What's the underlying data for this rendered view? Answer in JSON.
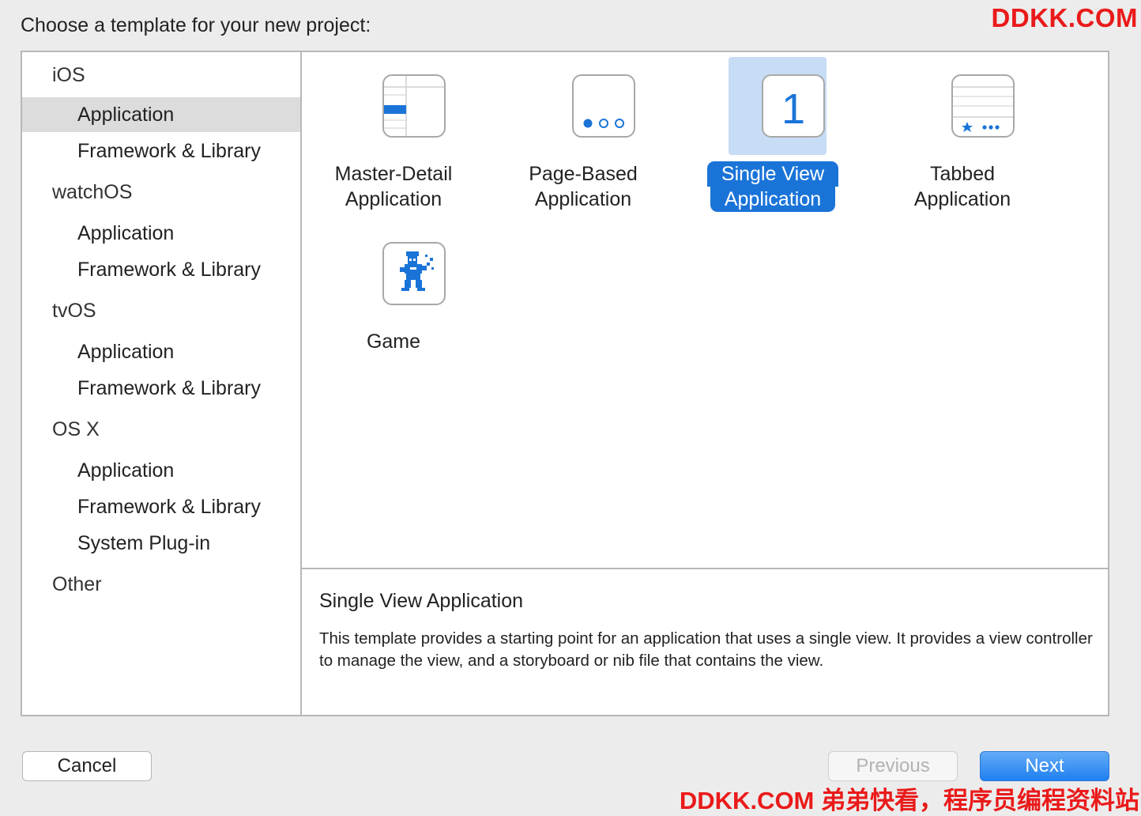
{
  "header": {
    "title": "Choose a template for your new project:"
  },
  "watermark": {
    "top": "DDKK.COM",
    "bottom": "DDKK.COM 弟弟快看，程序员编程资料站"
  },
  "sidebar": {
    "groups": [
      {
        "label": "iOS",
        "items": [
          "Application",
          "Framework & Library"
        ]
      },
      {
        "label": "watchOS",
        "items": [
          "Application",
          "Framework & Library"
        ]
      },
      {
        "label": "tvOS",
        "items": [
          "Application",
          "Framework & Library"
        ]
      },
      {
        "label": "OS X",
        "items": [
          "Application",
          "Framework & Library",
          "System Plug-in"
        ]
      },
      {
        "label": "Other",
        "items": []
      }
    ],
    "selected": "iOS / Application"
  },
  "templates": [
    {
      "line1": "Master-Detail",
      "line2": "Application",
      "icon": "master-detail-icon",
      "selected": false
    },
    {
      "line1": "Page-Based",
      "line2": "Application",
      "icon": "page-based-icon",
      "selected": false
    },
    {
      "line1": "Single View",
      "line2": "Application",
      "icon": "single-view-icon",
      "icon_text": "1",
      "selected": true
    },
    {
      "line1": "Tabbed",
      "line2": "Application",
      "icon": "tabbed-icon",
      "selected": false
    },
    {
      "line1": "Game",
      "line2": "",
      "icon": "game-icon",
      "selected": false
    }
  ],
  "description": {
    "title": "Single View Application",
    "text": "This template provides a starting point for an application that uses a single view. It provides a view controller to manage the view, and a storyboard or nib file that contains the view."
  },
  "buttons": {
    "cancel": "Cancel",
    "previous": "Previous",
    "next": "Next"
  },
  "colors": {
    "accent": "#1a74d8",
    "selection_tile": "#c7dcf5",
    "icon_blue": "#1a74d8",
    "watermark": "#ea1a1a"
  }
}
